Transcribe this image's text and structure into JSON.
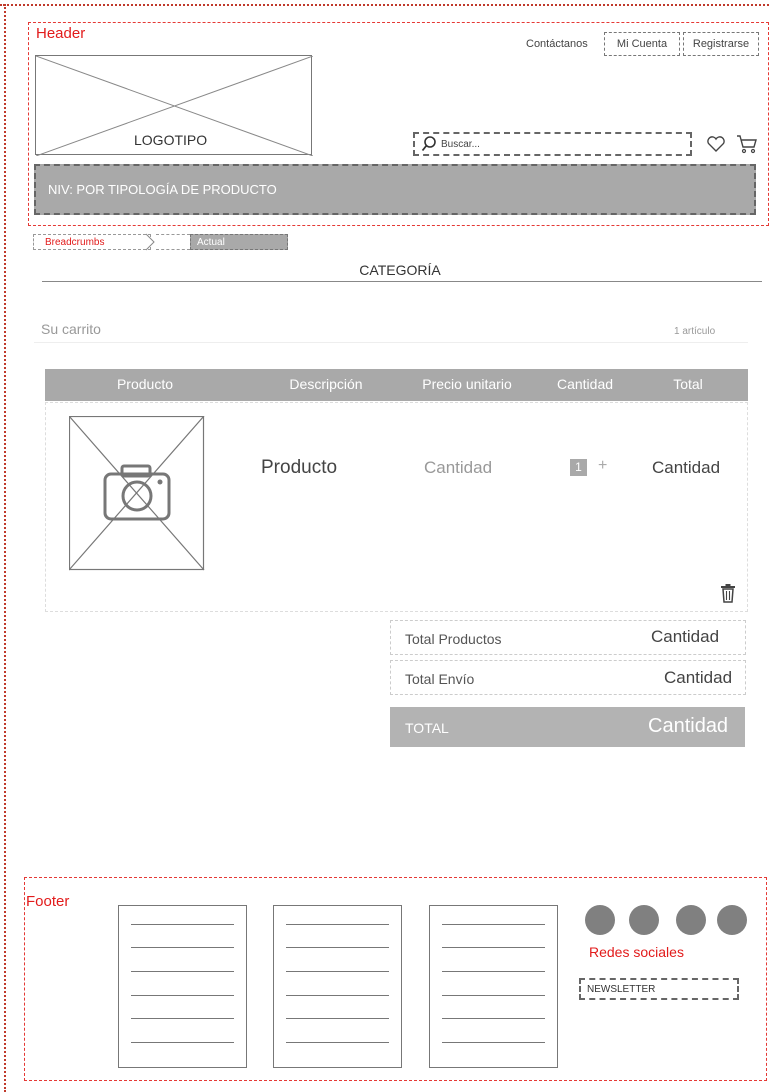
{
  "header": {
    "region_label": "Header",
    "links": {
      "contact": "Contáctanos",
      "account": "Mi Cuenta",
      "register": "Registrarse"
    },
    "logo_text": "LOGOTIPO",
    "search_placeholder": "Buscar...",
    "nav_text": "NIV: POR TIPOLOGÍA DE PRODUCTO"
  },
  "breadcrumbs": {
    "first": "Breadcrumbs",
    "current": "Actual"
  },
  "category_title": "CATEGORÍA",
  "cart": {
    "title": "Su carrito",
    "count": "1 artículo",
    "columns": [
      "Producto",
      "Descripción",
      "Precio unitario",
      "Cantidad",
      "Total"
    ],
    "row": {
      "name": "Producto",
      "unit_price": "Cantidad",
      "quantity": "1",
      "plus": "+",
      "total": "Cantidad"
    }
  },
  "summary": {
    "products_label": "Total Productos",
    "products_value": "Cantidad",
    "shipping_label": "Total Envío",
    "shipping_value": "Cantidad",
    "total_label": "TOTAL",
    "total_value": "Cantidad"
  },
  "footer": {
    "region_label": "Footer",
    "social_label": "Redes sociales",
    "newsletter": "NEWSLETTER"
  },
  "colors": {
    "accent": "#e21b1b",
    "bar_gray": "#a9a9a9"
  },
  "icons": [
    "search-icon",
    "heart-icon",
    "cart-icon",
    "chevron-right-icon",
    "camera-icon",
    "trash-icon"
  ]
}
